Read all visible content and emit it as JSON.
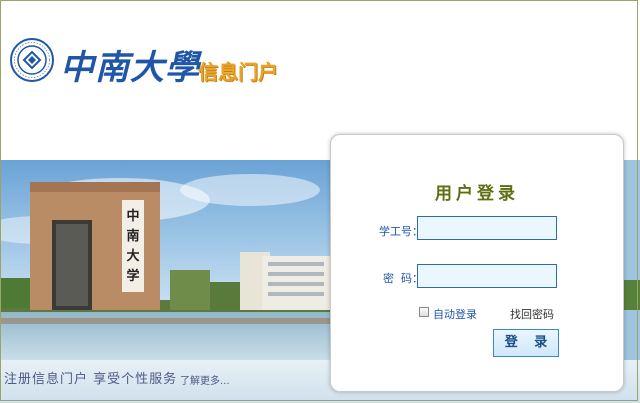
{
  "header": {
    "logo_text": "中南大學",
    "logo_subtitle": "信息门户",
    "seal_text": "CENTRAL SOUTH UNIVERSITY"
  },
  "banner": {
    "gate_text": "中南大学"
  },
  "footer": {
    "slogan": "注册信息门户 享受个性服务",
    "more_link": "了解更多..."
  },
  "login": {
    "title": "用户登录",
    "username_label": "学工号：",
    "username_value": "",
    "password_label": "密  码：",
    "password_value": "",
    "auto_login_label": "自动登录",
    "auto_login_checked": false,
    "forgot_label": "找回密码",
    "submit_label": "登 录"
  },
  "colors": {
    "brand_blue": "#1f56a8",
    "title_olive": "#5f6e10",
    "subtitle_gold": "#e8a52b",
    "field_bg": "#eaf7ff"
  }
}
